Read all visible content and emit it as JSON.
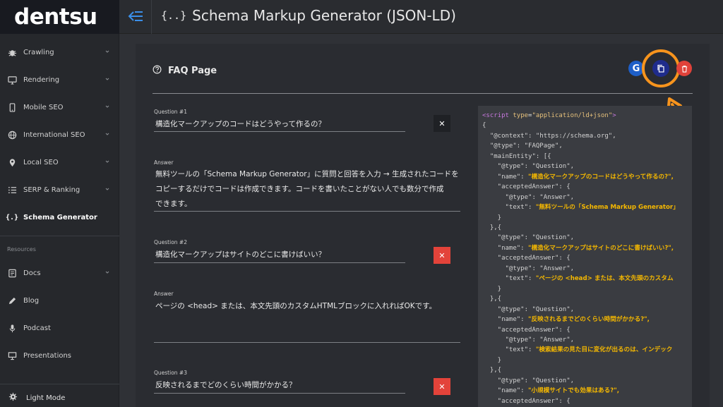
{
  "brand": {
    "logo_text": "dentsu"
  },
  "header": {
    "title": "Schema Markup Generator (JSON-LD)",
    "title_icon": "{..}"
  },
  "sidebar": {
    "items": [
      {
        "label": "Crawling",
        "icon": "bug-icon",
        "has_chevron": true
      },
      {
        "label": "Rendering",
        "icon": "monitor-icon",
        "has_chevron": true
      },
      {
        "label": "Mobile SEO",
        "icon": "mobile-icon",
        "has_chevron": true
      },
      {
        "label": "International SEO",
        "icon": "globe-icon",
        "has_chevron": true
      },
      {
        "label": "Local SEO",
        "icon": "pin-icon",
        "has_chevron": true
      },
      {
        "label": "SERP & Ranking",
        "icon": "list-icon",
        "has_chevron": true
      },
      {
        "label": "Schema Generator",
        "icon": "braces-icon",
        "has_chevron": false,
        "active": true
      }
    ],
    "resources_label": "Resources",
    "resources": [
      {
        "label": "Docs",
        "icon": "book-icon",
        "has_chevron": true
      },
      {
        "label": "Blog",
        "icon": "pencil-icon",
        "has_chevron": false
      },
      {
        "label": "Podcast",
        "icon": "mic-icon",
        "has_chevron": false
      },
      {
        "label": "Presentations",
        "icon": "presentation-icon",
        "has_chevron": false
      }
    ],
    "light_mode_label": "Light Mode"
  },
  "form": {
    "section_title": "FAQ Page",
    "questions": [
      {
        "q_label": "Question #1",
        "question": "構造化マークアップのコードはどうやって作るの？",
        "a_label": "Answer",
        "answer_lines": [
          "無料ツールの「Schema Markup Generator」に質問と回答を入力 → 生成されたコードを",
          "コピーするだけでコードは作成できます。コードを書いたことがない人でも数分で作成",
          "できます。"
        ]
      },
      {
        "q_label": "Question #2",
        "question": "構造化マークアップはサイトのどこに書けばいい？",
        "a_label": "Answer",
        "answer_lines": [
          "ページの <head> または、本文先頭のカスタムHTMLブロックに入れればOKです。"
        ]
      },
      {
        "q_label": "Question #3",
        "question": "反映されるまでどのくらい時間がかかる？"
      }
    ]
  },
  "toolbar": {
    "google_label": "G"
  },
  "code": {
    "open_tag": "<script",
    "type_attr": "type",
    "type_value": "\"application/ld+json\"",
    "tag_close": ">",
    "lines": [
      "{",
      "  \"@context\": \"https://schema.org\",",
      "  \"@type\": \"FAQPage\",",
      "  \"mainEntity\": [{",
      "    \"@type\": \"Question\",",
      "    \"name\": ",
      "    \"acceptedAnswer\": {",
      "      \"@type\": \"Answer\",",
      "      \"text\": ",
      "    }",
      "  },{",
      "    \"@type\": \"Question\",",
      "    \"name\": ",
      "    \"acceptedAnswer\": {",
      "      \"@type\": \"Answer\",",
      "      \"text\": ",
      "    }",
      "  },{",
      "    \"@type\": \"Question\",",
      "    \"name\": ",
      "    \"acceptedAnswer\": {",
      "      \"@type\": \"Answer\",",
      "      \"text\": ",
      "    }",
      "  },{",
      "    \"@type\": \"Question\",",
      "    \"name\": ",
      "    \"acceptedAnswer\": {"
    ],
    "highlights": {
      "q1_name": "\"構造化マークアップのコードはどうやって作るの?\",",
      "q1_text": "\"無料ツールの「Schema Markup Generator」",
      "q2_name": "\"構造化マークアップはサイトのどこに書けばいい?\",",
      "q2_text": "\"ページの <head> または、本文先頭のカスタム",
      "q3_name": "\"反映されるまでどのくらい時間がかかる?\",",
      "q3_text": "\"検索結果の見た目に変化が出るのは、インデック",
      "q4_name": "\"小規模サイトでも効果はある?\","
    }
  },
  "colors": {
    "accent_ring": "#f7941d",
    "delete_red": "#e3433a",
    "copy_navy": "#1f2c8c",
    "google_blue": "#1e5fc8",
    "string_highlight": "#f5b800"
  }
}
